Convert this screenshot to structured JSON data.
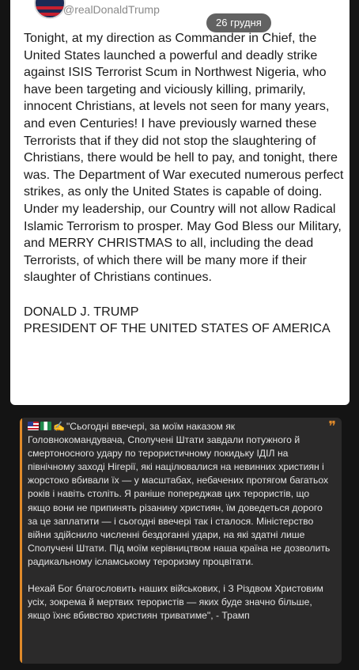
{
  "post": {
    "handle": "@realDonaldTrump",
    "date": "26 грудня",
    "body": "Tonight, at my direction as Commander in Chief, the United States launched a powerful and deadly strike against ISIS Terrorist Scum in Northwest Nigeria, who have been targeting and viciously killing, primarily, innocent Christians, at levels not seen for many years, and even Centuries! I have previously warned these Terrorists that if they did not stop the slaughtering of Christians, there would be hell to pay, and tonight, there was. The Department of War executed numerous perfect strikes, as only the United States is capable of doing. Under my leadership, our Country will not allow Radical Islamic Terrorism to prosper. May God Bless our Military, and MERRY CHRISTMAS to all, including the dead Terrorists, of which there will be many more if their slaughter of Christians continues.",
    "signature_name": "DONALD J. TRUMP",
    "signature_title": "PRESIDENT OF THE UNITED STATES OF AMERICA"
  },
  "quote": {
    "accent_color": "#e08a2a",
    "mark": "❞",
    "paragraph1": "\"Сьогодні ввечері, за моїм наказом як Головнокомандувача, Сполучені Штати завдали потужного й смертоносного удару по терористичному покидьку ІДІЛ на північному заході Нігерії, які націлювалися на невинних християн і жорстоко вбивали їх — у масштабах, небачених протягом багатьох років і навіть століть. Я раніше попереджав цих терористів, що якщо вони не припинять різанину християн, їм доведеться дорого за це заплатити — і сьогодні ввечері так і сталося. Міністерство війни здійснило численні бездоганні удари, на які здатні лише Сполучені Штати. Під моїм керівництвом наша країна не дозволить радикальному ісламському тероризму процвітати.",
    "paragraph2": "Нехай Бог благословить наших військових, і З Різдвом Христовим усіх, зокрема й мертвих терористів — яких буде значно більше, якщо їхнє вбивство християн триватиме\",  - Трамп",
    "icons": [
      "us-flag-icon",
      "nigeria-flag-icon",
      "writing-hand-icon"
    ]
  }
}
